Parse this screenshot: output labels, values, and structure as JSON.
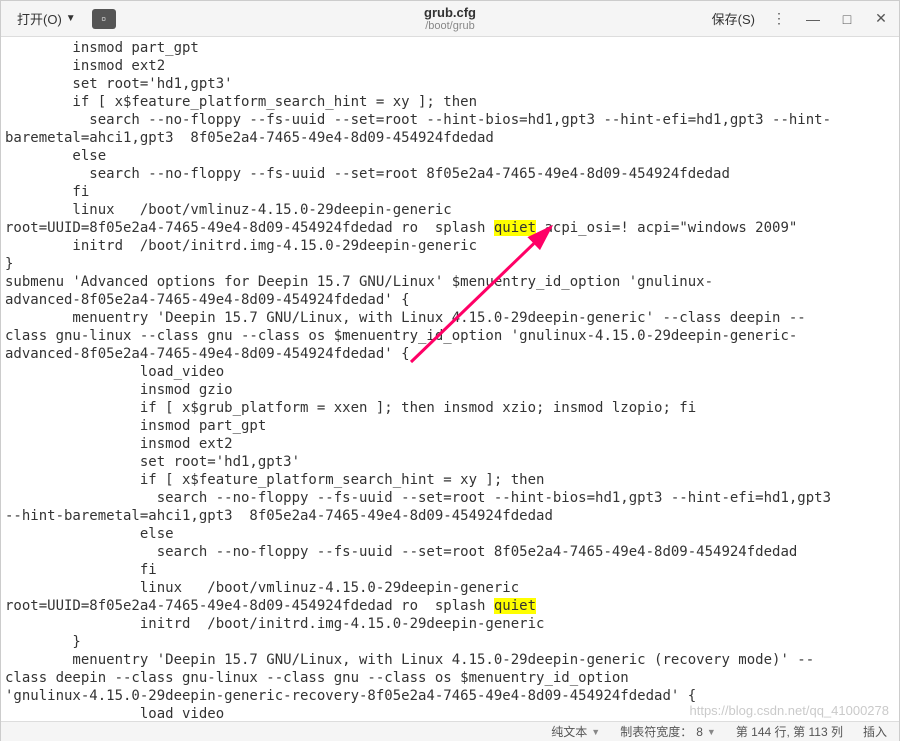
{
  "titlebar": {
    "open_label": "打开(O)",
    "title": "grub.cfg",
    "subtitle": "/boot/grub",
    "save_label": "保存(S)"
  },
  "editor": {
    "lines": [
      "        insmod part_gpt",
      "        insmod ext2",
      "        set root='hd1,gpt3'",
      "        if [ x$feature_platform_search_hint = xy ]; then",
      "          search --no-floppy --fs-uuid --set=root --hint-bios=hd1,gpt3 --hint-efi=hd1,gpt3 --hint-",
      "baremetal=ahci1,gpt3  8f05e2a4-7465-49e4-8d09-454924fdedad",
      "        else",
      "          search --no-floppy --fs-uuid --set=root 8f05e2a4-7465-49e4-8d09-454924fdedad",
      "        fi",
      "        linux   /boot/vmlinuz-4.15.0-29deepin-generic ",
      "root=UUID=8f05e2a4-7465-49e4-8d09-454924fdedad ro  splash ",
      " acpi_osi=! acpi=\"windows 2009\"",
      "        initrd  /boot/initrd.img-4.15.0-29deepin-generic",
      "}",
      "submenu 'Advanced options for Deepin 15.7 GNU/Linux' $menuentry_id_option 'gnulinux-",
      "advanced-8f05e2a4-7465-49e4-8d09-454924fdedad' {",
      "        menuentry 'Deepin 15.7 GNU/Linux, with Linux 4.15.0-29deepin-generic' --class deepin --",
      "class gnu-linux --class gnu --class os $menuentry_id_option 'gnulinux-4.15.0-29deepin-generic-",
      "advanced-8f05e2a4-7465-49e4-8d09-454924fdedad' {",
      "                load_video",
      "                insmod gzio",
      "                if [ x$grub_platform = xxen ]; then insmod xzio; insmod lzopio; fi",
      "                insmod part_gpt",
      "                insmod ext2",
      "                set root='hd1,gpt3'",
      "                if [ x$feature_platform_search_hint = xy ]; then",
      "                  search --no-floppy --fs-uuid --set=root --hint-bios=hd1,gpt3 --hint-efi=hd1,gpt3 ",
      "--hint-baremetal=ahci1,gpt3  8f05e2a4-7465-49e4-8d09-454924fdedad",
      "                else",
      "                  search --no-floppy --fs-uuid --set=root 8f05e2a4-7465-49e4-8d09-454924fdedad",
      "                fi",
      "                linux   /boot/vmlinuz-4.15.0-29deepin-generic ",
      "root=UUID=8f05e2a4-7465-49e4-8d09-454924fdedad ro  splash ",
      "",
      "                initrd  /boot/initrd.img-4.15.0-29deepin-generic",
      "        }",
      "        menuentry 'Deepin 15.7 GNU/Linux, with Linux 4.15.0-29deepin-generic (recovery mode)' --",
      "class deepin --class gnu-linux --class gnu --class os $menuentry_id_option ",
      "'gnulinux-4.15.0-29deepin-generic-recovery-8f05e2a4-7465-49e4-8d09-454924fdedad' {",
      "                load_video"
    ],
    "highlight_word": "quiet"
  },
  "statusbar": {
    "filetype": "纯文本",
    "tabwidth_label": "制表符宽度：",
    "tabwidth_value": "8",
    "position": "第 144 行, 第 113 列",
    "mode": "插入"
  },
  "watermark": "https://blog.csdn.net/qq_41000278"
}
